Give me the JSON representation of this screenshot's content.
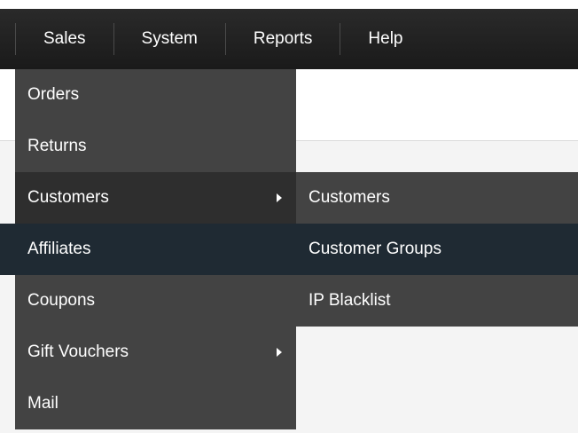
{
  "nav": {
    "items": [
      "Sales",
      "System",
      "Reports",
      "Help"
    ]
  },
  "menu": {
    "items": [
      {
        "label": "Orders",
        "has_submenu": false
      },
      {
        "label": "Returns",
        "has_submenu": false
      },
      {
        "label": "Customers",
        "has_submenu": true
      },
      {
        "label": "Affiliates",
        "has_submenu": false
      },
      {
        "label": "Coupons",
        "has_submenu": false
      },
      {
        "label": "Gift Vouchers",
        "has_submenu": true
      },
      {
        "label": "Mail",
        "has_submenu": false
      }
    ]
  },
  "submenu": {
    "items": [
      "Customers",
      "Customer Groups",
      "IP Blacklist"
    ]
  },
  "colors": {
    "navbar": "#1a1a1a",
    "menu": "#434343",
    "hover": "#1f2a33",
    "accent": "#7aa5c3"
  }
}
